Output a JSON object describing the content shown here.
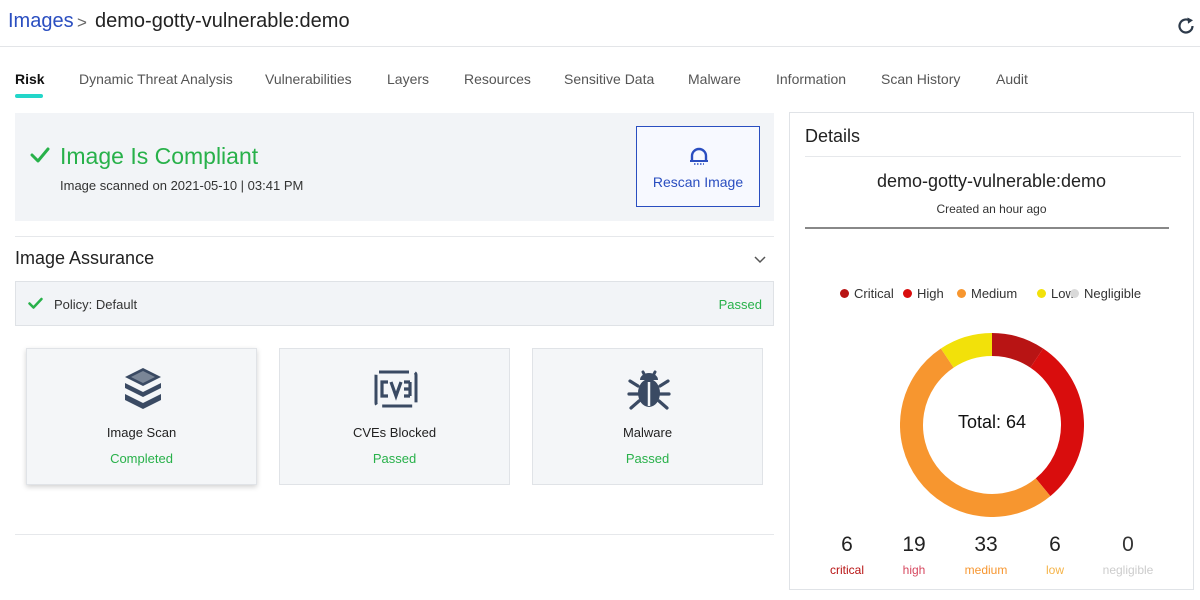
{
  "breadcrumb": {
    "root": "Images",
    "separator": ">",
    "current": "demo-gotty-vulnerable:demo"
  },
  "header": {
    "refresh_icon": "refresh-icon"
  },
  "tabs": [
    {
      "label": "Risk",
      "active": true
    },
    {
      "label": "Dynamic Threat Analysis"
    },
    {
      "label": "Vulnerabilities"
    },
    {
      "label": "Layers"
    },
    {
      "label": "Resources"
    },
    {
      "label": "Sensitive Data"
    },
    {
      "label": "Malware"
    },
    {
      "label": "Information"
    },
    {
      "label": "Scan History"
    },
    {
      "label": "Audit"
    }
  ],
  "compliance": {
    "title": "Image Is Compliant",
    "scanned": "Image scanned on 2021-05-10 | 03:41 PM",
    "rescan_label": "Rescan Image",
    "color": "#28b14a"
  },
  "assurance": {
    "title": "Image Assurance",
    "policy_label": "Policy: Default",
    "policy_status": "Passed",
    "cards": [
      {
        "title": "Image Scan",
        "status": "Completed",
        "icon": "layers-stack-icon"
      },
      {
        "title": "CVEs Blocked",
        "status": "Passed",
        "icon": "cve-icon"
      },
      {
        "title": "Malware",
        "status": "Passed",
        "icon": "bug-icon"
      }
    ]
  },
  "details": {
    "title": "Details",
    "image_name": "demo-gotty-vulnerable:demo",
    "created": "Created an hour ago"
  },
  "chart_data": {
    "type": "pie",
    "total_label": "Total: 64",
    "categories": [
      "critical",
      "high",
      "medium",
      "low",
      "negligible"
    ],
    "legend": [
      "Critical",
      "High",
      "Medium",
      "Low",
      "Negligible"
    ],
    "values": [
      6,
      19,
      33,
      6,
      0
    ],
    "colors": [
      "#b81414",
      "#d90d0d",
      "#f7962f",
      "#f2e10a",
      "#d9d9d9"
    ],
    "label_colors": [
      "#b81414",
      "#d6475f",
      "#f7962f",
      "#f5b347",
      "#cccccc"
    ],
    "legend_placement": "top"
  }
}
